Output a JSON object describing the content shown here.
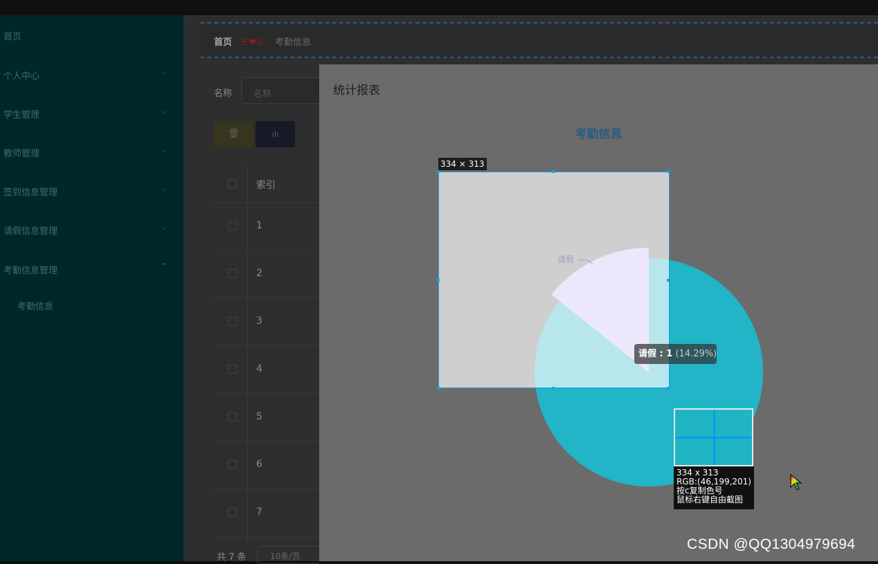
{
  "sidebar": {
    "items": [
      {
        "label": "首页",
        "expandable": false
      },
      {
        "label": "个人中心",
        "expandable": true,
        "chevron": "⌵"
      },
      {
        "label": "学生管理",
        "expandable": true,
        "chevron": "⌵"
      },
      {
        "label": "教师管理",
        "expandable": true,
        "chevron": "⌵"
      },
      {
        "label": "签到信息管理",
        "expandable": true,
        "chevron": "⌵"
      },
      {
        "label": "请假信息管理",
        "expandable": true,
        "chevron": "⌵"
      },
      {
        "label": "考勤信息管理",
        "expandable": true,
        "chevron": "^"
      }
    ],
    "subitem": "考勤信息"
  },
  "breadcrumb": {
    "home": "首页",
    "emoticon": "웃❤유",
    "current": "考勤信息"
  },
  "filter": {
    "label": "名称",
    "placeholder": "名称"
  },
  "toolbar": {
    "delete_icon": "trash-icon",
    "delete_glyph": "🗑",
    "chart_icon": "bar-chart-icon",
    "chart_glyph": "ılı"
  },
  "table": {
    "header": "索引",
    "rows": [
      "1",
      "2",
      "3",
      "4",
      "5",
      "6",
      "7"
    ]
  },
  "pagination": {
    "total": "共 7 条",
    "page_size": "10条/页"
  },
  "dialog": {
    "title": "统计报表"
  },
  "chart_data": {
    "type": "pie",
    "title": "考勤信息",
    "slices": [
      {
        "name": "请假",
        "value": 1,
        "percent": 14.29,
        "color": "#c6b5f2"
      },
      {
        "name": "",
        "value": 6,
        "percent": 85.71,
        "color": "#21b5c7"
      }
    ],
    "tooltip": {
      "name": "请假",
      "value": "1",
      "percent": "(14.29%)"
    }
  },
  "screenshot_tool": {
    "size_label": "334 × 313",
    "info_size": "334 x 313",
    "info_rgb": "RGB:(46,199,201)",
    "info_hint1": "按c复制色号",
    "info_hint2": "鼠标右键自由截图"
  },
  "watermark": "CSDN @QQ1304979694",
  "colors": {
    "sidebar_bg": "#00262a",
    "pie_main": "#21b5c7",
    "pie_leave": "#c6b5f2",
    "selection": "#1a9ee8"
  }
}
